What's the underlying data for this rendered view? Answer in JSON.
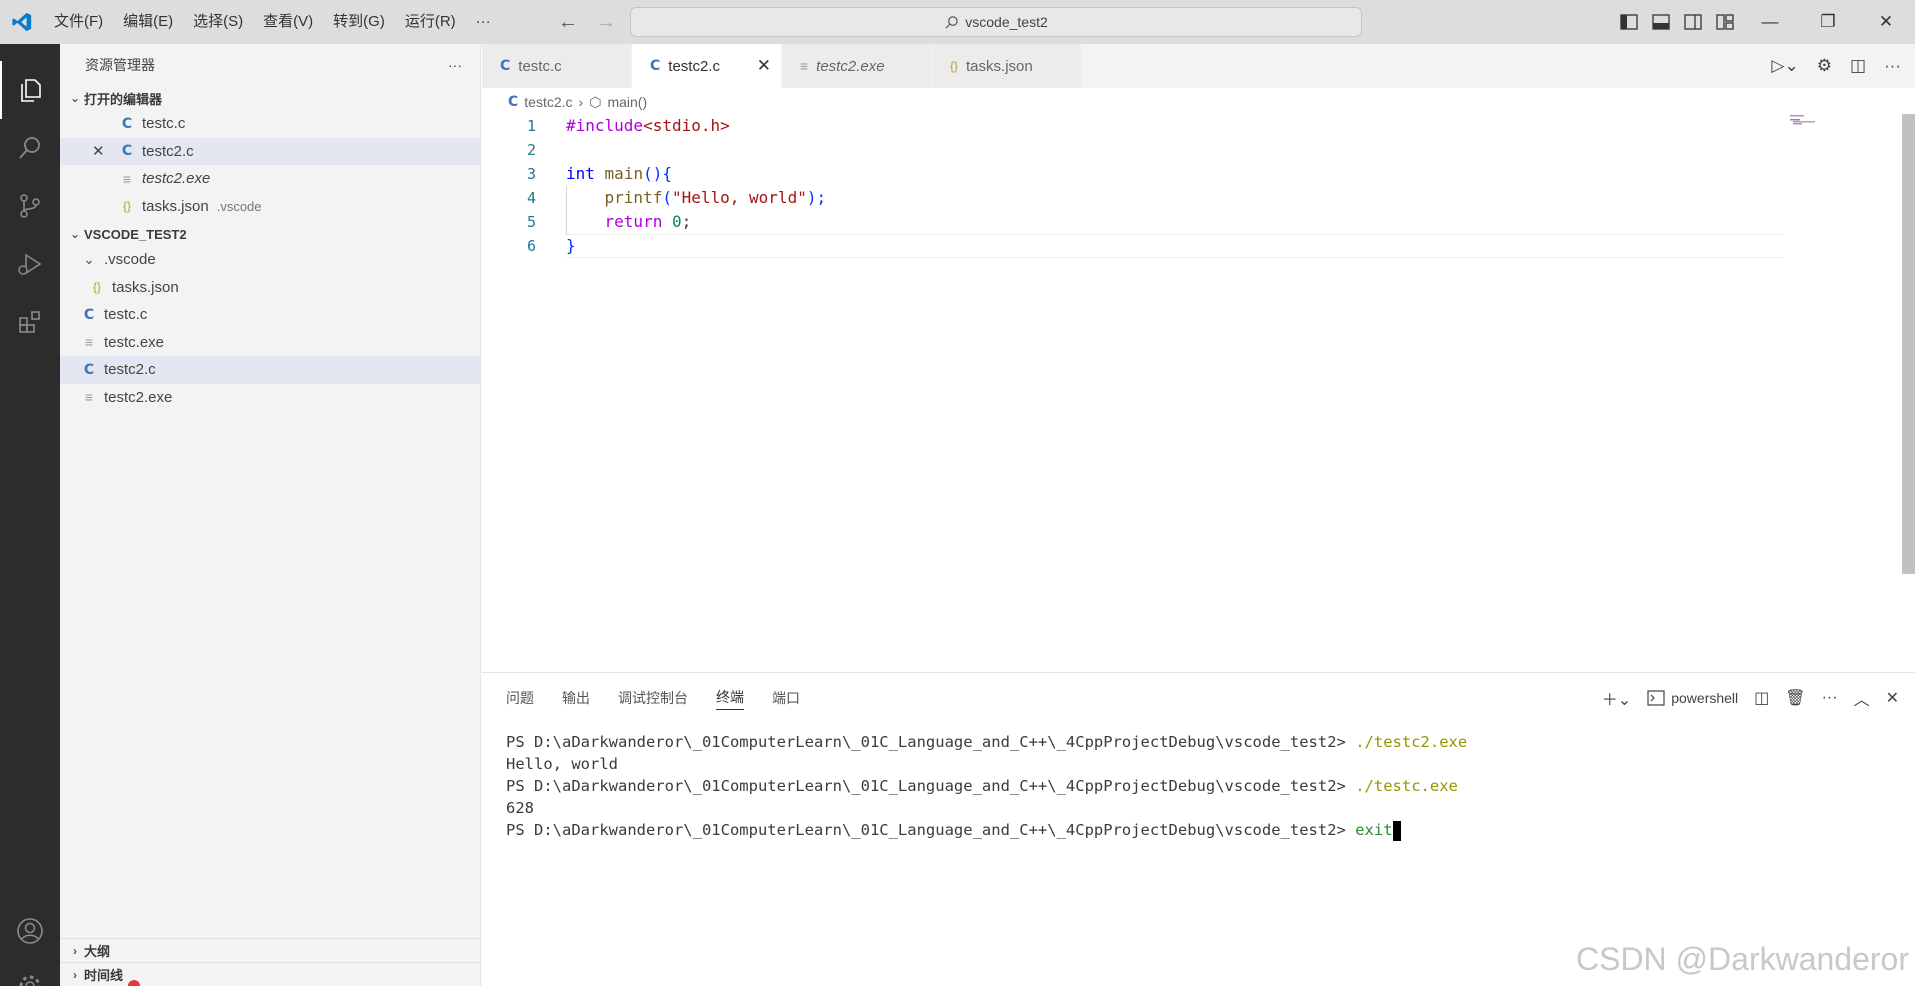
{
  "titlebar": {
    "menu": [
      "文件(F)",
      "编辑(E)",
      "选择(S)",
      "查看(V)",
      "转到(G)",
      "运行(R)",
      "···"
    ],
    "search": "vscode_test2"
  },
  "sidebar": {
    "title": "资源管理器",
    "more": "···",
    "open_editors": {
      "header": "打开的编辑器",
      "items": [
        {
          "icon": "C",
          "name": "testc.c",
          "desc": ""
        },
        {
          "icon": "C",
          "name": "testc2.c",
          "desc": ""
        },
        {
          "icon": "≡",
          "name": "testc2.exe",
          "desc": ""
        },
        {
          "icon": "{}",
          "name": "tasks.json",
          "desc": ".vscode"
        }
      ]
    },
    "workspace": {
      "header": "VSCODE_TEST2",
      "items": [
        {
          "icon": "⌄",
          "name": ".vscode"
        },
        {
          "icon": "{}",
          "name": "tasks.json"
        },
        {
          "icon": "C",
          "name": "testc.c"
        },
        {
          "icon": "≡",
          "name": "testc.exe"
        },
        {
          "icon": "C",
          "name": "testc2.c"
        },
        {
          "icon": "≡",
          "name": "testc2.exe"
        }
      ]
    },
    "outline": "大纲",
    "timeline": "时间线"
  },
  "tabs": [
    {
      "icon": "C",
      "label": "testc.c"
    },
    {
      "icon": "C",
      "label": "testc2.c"
    },
    {
      "icon": "≡",
      "label": "testc2.exe"
    },
    {
      "icon": "{}",
      "label": "tasks.json"
    }
  ],
  "breadcrumb": {
    "file": "testc2.c",
    "symbol": "main()"
  },
  "code": {
    "line_numbers": [
      "1",
      "2",
      "3",
      "4",
      "5",
      "6"
    ],
    "l1_directive": "#include",
    "l1_header": "<stdio.h>",
    "l3_type": "int",
    "l3_fn": "main",
    "l3_rest": "(){",
    "l4_fn": "printf",
    "l4_open": "(",
    "l4_str": "\"Hello, world\"",
    "l4_close": ");",
    "l5_kw": "return",
    "l5_num": "0",
    "l5_end": ";",
    "l6": "}"
  },
  "panel": {
    "tabs": [
      "问题",
      "输出",
      "调试控制台",
      "终端",
      "端口"
    ],
    "shell": "powershell",
    "terminal": {
      "prompt": "PS D:\\aDarkwanderor\\_01ComputerLearn\\_01C_Language_and_C++\\_4CppProjectDebug\\vscode_test2> ",
      "cmd1": "./testc2.exe",
      "out1": "Hello, world",
      "cmd2": "./testc.exe",
      "out2": "628",
      "cmd3": "exit"
    }
  },
  "watermark": "CSDN @Darkwanderor"
}
